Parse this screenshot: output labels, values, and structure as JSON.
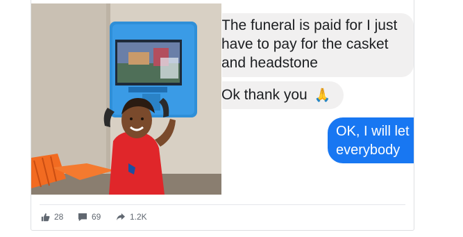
{
  "chat": {
    "message_1": "The funeral is paid for I just have to pay for the casket and headstone",
    "message_2": "Ok thank you",
    "message_2_emoji": "🙏",
    "message_3": "OK, I will let everybody"
  },
  "reactions": {
    "likes": "28",
    "comments": "69",
    "shares": "1.2K"
  },
  "icons": [
    "like-icon",
    "comment-icon",
    "share-icon",
    "praying-hands-emoji"
  ],
  "colors": {
    "outgoing_bubble": "#1877f2",
    "incoming_bubble": "#f1f0f0",
    "kiosk_blue": "#2f8fd8",
    "shirt_red": "#e0262a",
    "chair_orange": "#f26b21"
  }
}
